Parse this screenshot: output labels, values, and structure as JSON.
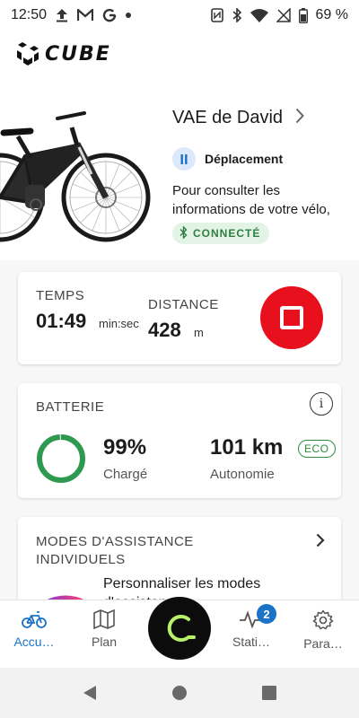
{
  "statusbar": {
    "time": "12:50",
    "battery": "69 %"
  },
  "brand": {
    "logo_text": "CUBE"
  },
  "bike": {
    "name": "VAE de David",
    "mode": "Déplacement",
    "info_text": "Pour consulter les informations de votre vélo, lancez un trajet",
    "connection": "CONNECTÉ"
  },
  "trip": {
    "time_label": "TEMPS",
    "time_value": "01:49",
    "time_unit": "min:sec",
    "distance_label": "DISTANCE",
    "distance_value": "428",
    "distance_unit": "m"
  },
  "battery": {
    "title": "BATTERIE",
    "percent": "99%",
    "percent_label": "Chargé",
    "percent_value": 0.99,
    "range": "101 km",
    "range_label": "Autonomie",
    "range_mode": "ECO"
  },
  "modes": {
    "title": "MODES D'ASSISTANCE INDIVIDUELS",
    "text": "Personnaliser les modes d'assistance"
  },
  "nav": {
    "home": "Accu…",
    "plan": "Plan",
    "stats": "Stati…",
    "stats_badge": "2",
    "params": "Para…"
  },
  "colors": {
    "accent": "#1a73c7",
    "stop": "#e8101c",
    "battery_green": "#2e9a4f",
    "connected_bg": "#e3f4e6",
    "center_glow": "#b5f26a"
  }
}
